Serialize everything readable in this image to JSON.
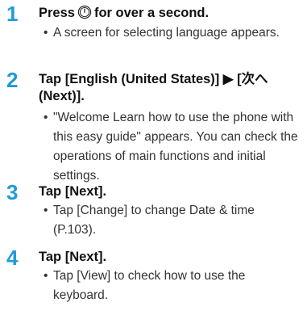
{
  "steps": [
    {
      "number": "1",
      "title_prefix": "Press",
      "title_icon": "power-key-icon",
      "title_suffix": "for over a second.",
      "description": "A screen for selecting language appears."
    },
    {
      "number": "2",
      "title": "Tap [English (United States)] ▶ [次へ (Next)].",
      "description": "\"Welcome Learn how to use the phone with this easy guide\" appears. You can check the operations of main functions and initial settings."
    },
    {
      "number": "3",
      "title": "Tap [Next].",
      "description": "Tap [Change] to change Date & time (P.103)."
    },
    {
      "number": "4",
      "title": "Tap [Next].",
      "description": "Tap [View] to check how to use the keyboard."
    }
  ],
  "bullet_char": "•",
  "colors": {
    "step_number": "#1f9bd7",
    "title_text": "#111111",
    "desc_text": "#333333"
  }
}
